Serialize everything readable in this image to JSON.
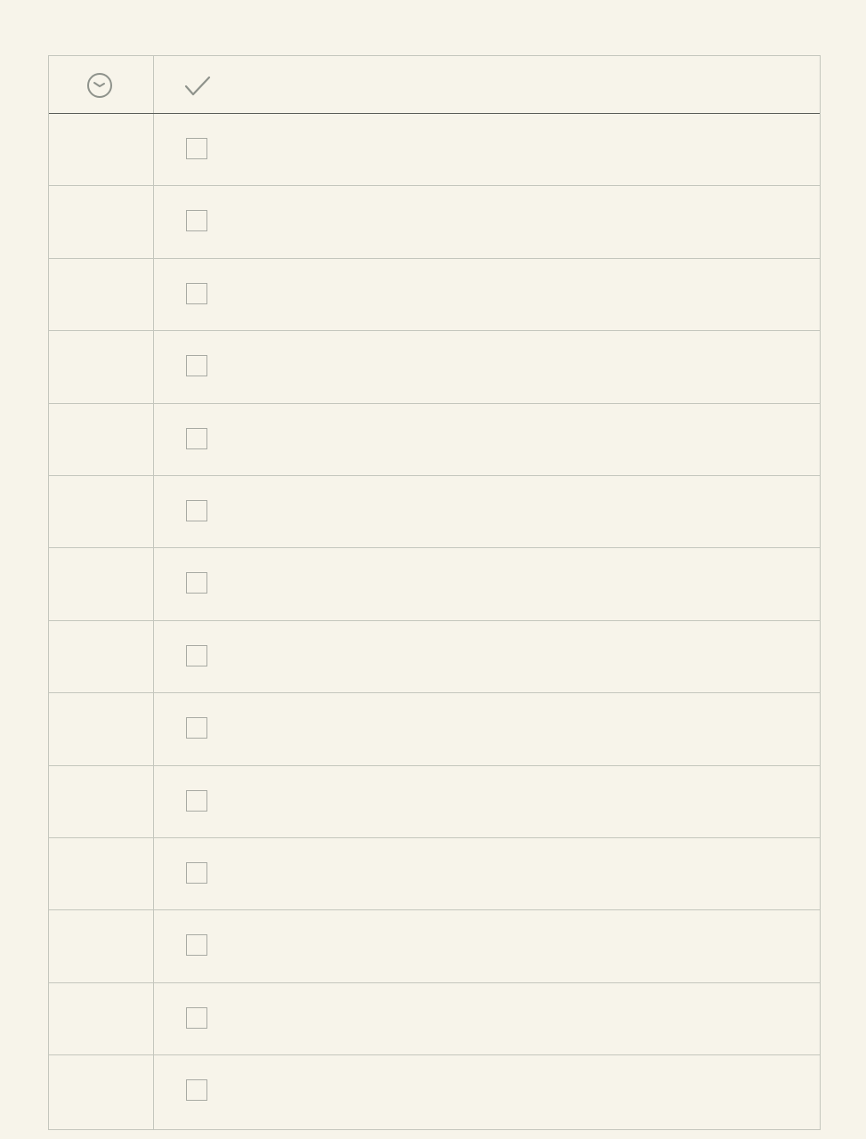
{
  "header": {
    "time_icon": "clock-icon",
    "done_icon": "checkmark-icon"
  },
  "rows": [
    {
      "time": "",
      "task": "",
      "checked": false
    },
    {
      "time": "",
      "task": "",
      "checked": false
    },
    {
      "time": "",
      "task": "",
      "checked": false
    },
    {
      "time": "",
      "task": "",
      "checked": false
    },
    {
      "time": "",
      "task": "",
      "checked": false
    },
    {
      "time": "",
      "task": "",
      "checked": false
    },
    {
      "time": "",
      "task": "",
      "checked": false
    },
    {
      "time": "",
      "task": "",
      "checked": false
    },
    {
      "time": "",
      "task": "",
      "checked": false
    },
    {
      "time": "",
      "task": "",
      "checked": false
    },
    {
      "time": "",
      "task": "",
      "checked": false
    },
    {
      "time": "",
      "task": "",
      "checked": false
    },
    {
      "time": "",
      "task": "",
      "checked": false
    },
    {
      "time": "",
      "task": "",
      "checked": false
    }
  ],
  "colors": {
    "background": "#f7f4ea",
    "rule": "#c4c6bd",
    "header_rule": "#5a5d58",
    "icon": "#8e928b",
    "checkbox": "#a8aaa3"
  }
}
